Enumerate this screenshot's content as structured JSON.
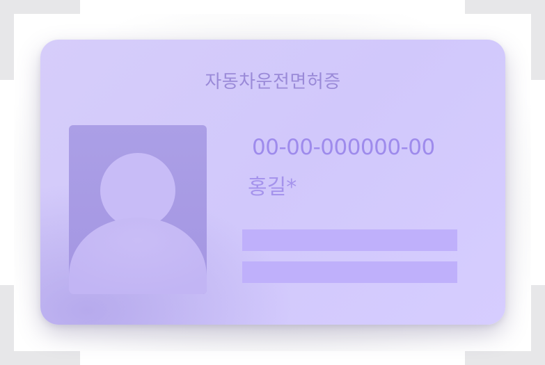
{
  "card": {
    "title": "자동차운전면허증",
    "license_number": "00-00-000000-00",
    "holder_name": "홍길*"
  },
  "icons": {
    "photo": "person-silhouette-icon"
  },
  "colors": {
    "card_background": "#d3cafb",
    "photo_background": "#a89be4",
    "silhouette": "#c8bcf7",
    "text": "#9e8bec",
    "placeholder_bar": "#bfb0fb",
    "frame_corner": "#e7e7e9"
  }
}
